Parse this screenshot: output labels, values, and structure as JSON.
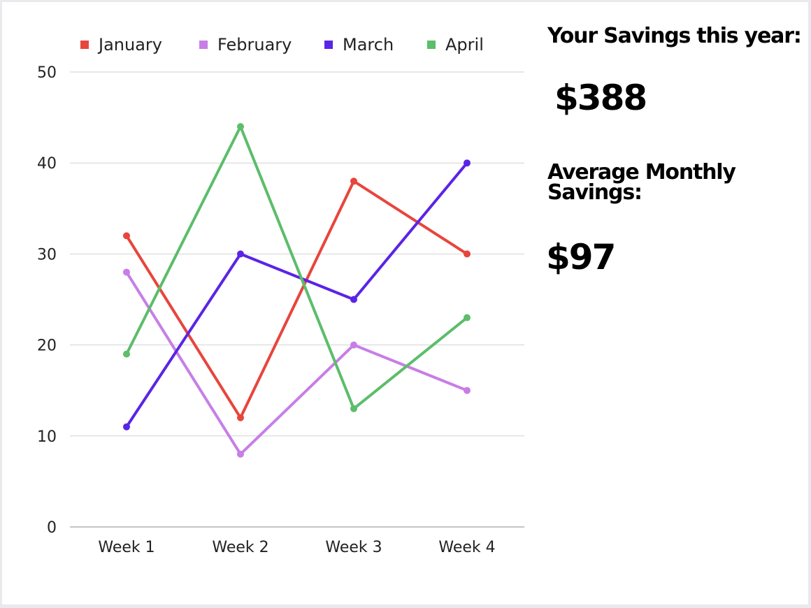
{
  "chart_data": {
    "type": "line",
    "categories": [
      "Week 1",
      "Week 2",
      "Week 3",
      "Week 4"
    ],
    "series": [
      {
        "name": "January",
        "color": "#e8453c",
        "values": [
          32,
          12,
          38,
          30
        ]
      },
      {
        "name": "February",
        "color": "#c77ee6",
        "values": [
          28,
          8,
          20,
          15
        ]
      },
      {
        "name": "March",
        "color": "#5a24e6",
        "values": [
          11,
          30,
          25,
          40
        ]
      },
      {
        "name": "April",
        "color": "#5cbd6b",
        "values": [
          19,
          44,
          13,
          23
        ]
      }
    ],
    "ylim": [
      0,
      50
    ],
    "yticks": [
      0,
      10,
      20,
      30,
      40,
      50
    ],
    "grid": true,
    "legend": "top"
  },
  "stats": {
    "total_heading": "Your Savings this year:",
    "total_value": "$388",
    "average_heading": "Average Monthly Savings:",
    "average_value": "$97"
  }
}
